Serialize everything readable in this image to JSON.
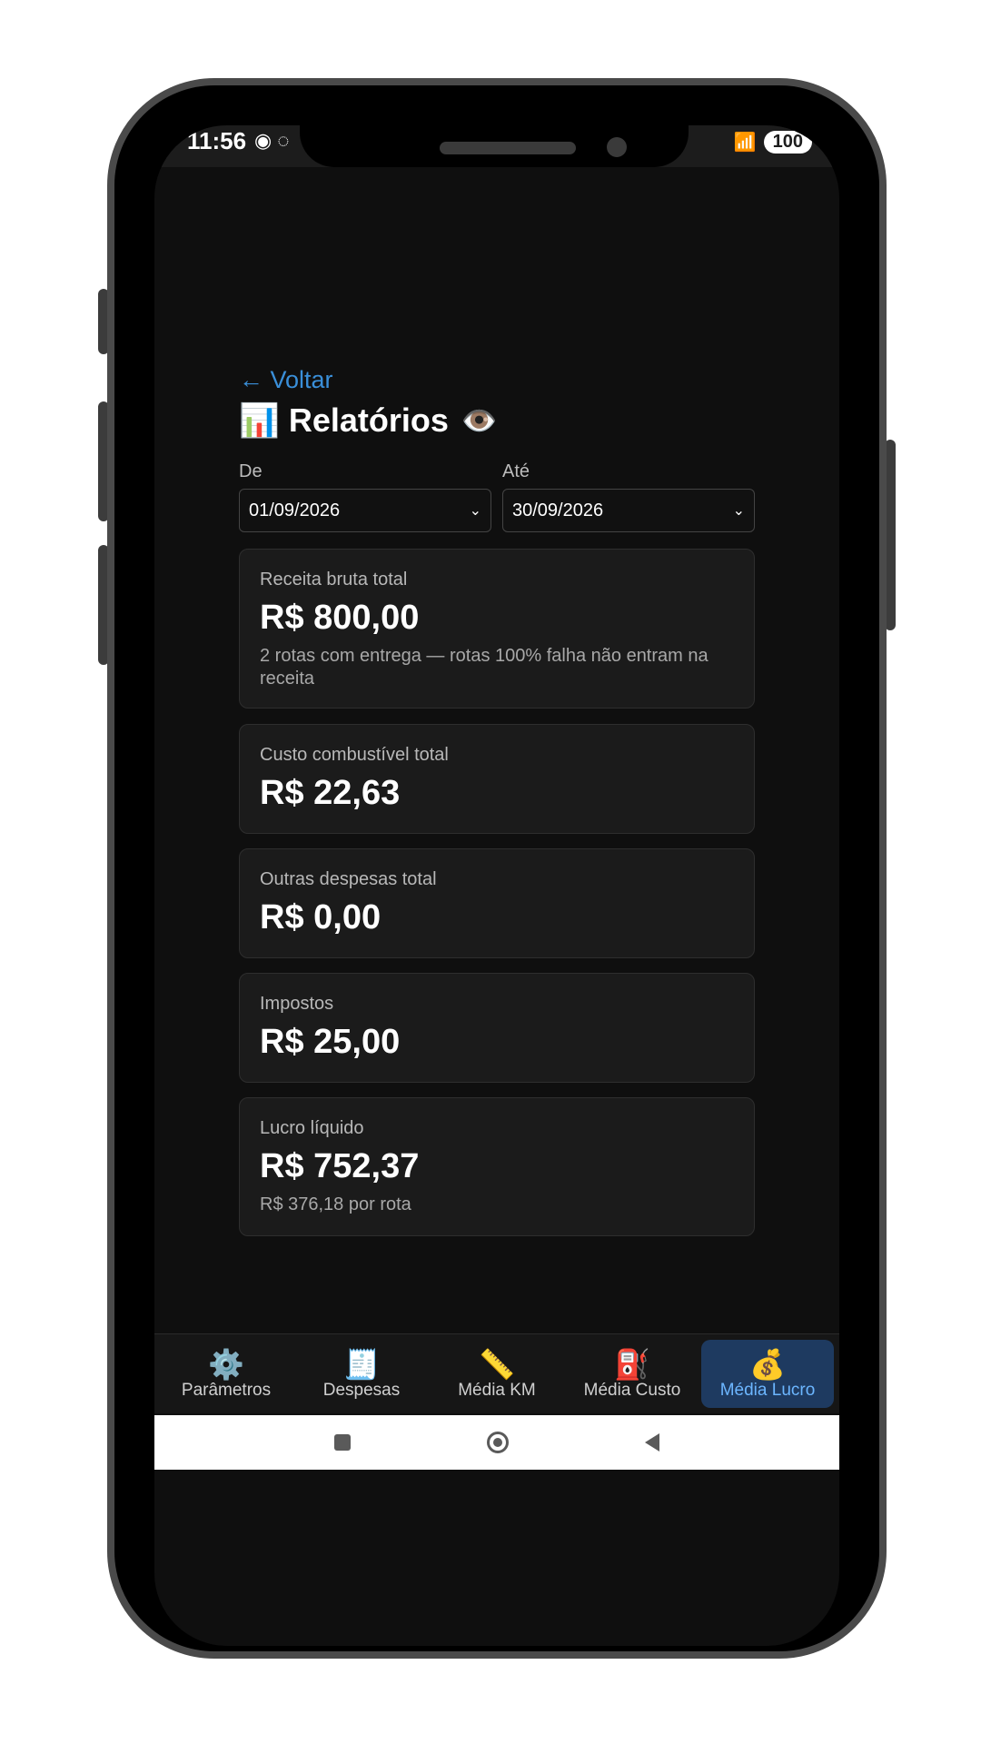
{
  "status_bar": {
    "time": "11:56",
    "left_icons": [
      "eye-notification-icon",
      "whatsapp-icon"
    ],
    "right_icons": [
      "wifi-icon",
      "signal-icon"
    ],
    "battery": "100"
  },
  "header": {
    "back_label": "← Voltar",
    "title": "Relatórios",
    "title_icon": "📊",
    "eye_icon": "👁️"
  },
  "filters": {
    "from_label": "De",
    "from_value": "01/09/2026",
    "to_label": "Até",
    "to_value": "30/09/2026"
  },
  "cards": {
    "revenue": {
      "label": "Receita bruta total",
      "value": "R$ 800,00",
      "note": "2 rotas com entrega — rotas 100% falha não entram na receita"
    },
    "fuel": {
      "label": "Custo combustível total",
      "value": "R$ 22,63"
    },
    "other": {
      "label": "Outras despesas total",
      "value": "R$ 0,00"
    },
    "taxes": {
      "label": "Impostos",
      "value": "R$ 25,00"
    },
    "profit": {
      "label": "Lucro líquido",
      "value": "R$ 752,37",
      "note": "R$ 376,18 por rota"
    }
  },
  "bottom_nav": [
    {
      "label": "Parâmetros",
      "icon": "⚙️",
      "icon_name": "gear-icon"
    },
    {
      "label": "Despesas",
      "icon": "🧾",
      "icon_name": "receipt-icon"
    },
    {
      "label": "Média KM",
      "icon": "📏",
      "icon_name": "ruler-icon"
    },
    {
      "label": "Média Custo",
      "icon": "⛽",
      "icon_name": "fuel-pump-icon"
    },
    {
      "label": "Média Lucro",
      "icon": "💰",
      "icon_name": "money-bag-icon",
      "active": true
    }
  ],
  "colors": {
    "accent": "#3a8fd9",
    "background": "#0f0f0f",
    "card": "#1b1b1b",
    "active_tab_bg": "#1e3a60",
    "active_tab_text": "#6cb6ff"
  }
}
